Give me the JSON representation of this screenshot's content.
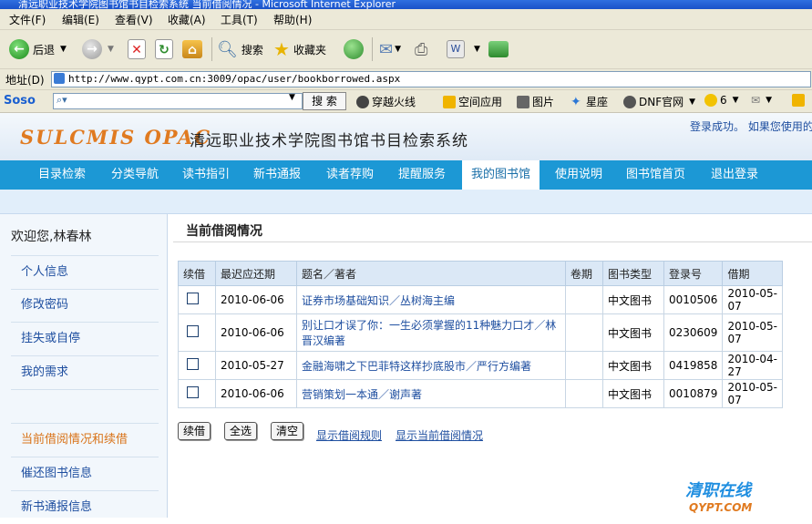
{
  "window": {
    "title": "清远职业技术学院图书馆书目检索系统 当前借阅情况 - Microsoft Internet Explorer"
  },
  "menu": [
    "文件(F)",
    "编辑(E)",
    "查看(V)",
    "收藏(A)",
    "工具(T)",
    "帮助(H)"
  ],
  "toolbar": {
    "back": "后退",
    "search": "搜索",
    "favorites": "收藏夹"
  },
  "address": {
    "label": "地址(D)",
    "url": "http://www.qypt.com.cn:3009/opac/user/bookborrowed.aspx"
  },
  "soso": {
    "brand": "Soso",
    "search_btn": "搜 索",
    "items": [
      "穿越火线",
      "空间应用",
      "图片",
      "星座",
      "DNF官网",
      "6"
    ]
  },
  "site": {
    "logo_en": "SULCMIS OPAC",
    "logo_cn": "清远职业技术学院图书馆书目检索系统",
    "login_msg": "登录成功。 如果您使用的"
  },
  "nav": [
    "目录检索",
    "分类导航",
    "读书指引",
    "新书通报",
    "读者荐购",
    "提醒服务",
    "我的图书馆",
    "使用说明",
    "图书馆首页",
    "退出登录"
  ],
  "sidebar": {
    "welcome": "欢迎您,林春林",
    "items": [
      "个人信息",
      "修改密码",
      "挂失或自停",
      "我的需求",
      "",
      "当前借阅情况和续借",
      "催还图书信息",
      "新书通报信息"
    ]
  },
  "main": {
    "title": "当前借阅情况",
    "headers": [
      "续借",
      "最迟应还期",
      "题名／著者",
      "卷期",
      "图书类型",
      "登录号",
      "借期"
    ],
    "rows": [
      {
        "due": "2010-06-06",
        "title": "证券市场基础知识／丛树海主编",
        "vol": "",
        "type": "中文图书",
        "reg": "0010506",
        "borrow": "2010-05-07"
      },
      {
        "due": "2010-06-06",
        "title": "别让口才误了你：一生必须掌握的11种魅力口才／林晋汉编著",
        "vol": "",
        "type": "中文图书",
        "reg": "0230609",
        "borrow": "2010-05-07"
      },
      {
        "due": "2010-05-27",
        "title": "金融海啸之下巴菲特这样抄底股市／严行方编著",
        "vol": "",
        "type": "中文图书",
        "reg": "0419858",
        "borrow": "2010-04-27"
      },
      {
        "due": "2010-06-06",
        "title": "营销策划一本通／谢声著",
        "vol": "",
        "type": "中文图书",
        "reg": "0010879",
        "borrow": "2010-05-07"
      }
    ],
    "buttons": {
      "renew": "续借",
      "select_all": "全选",
      "clear": "清空"
    },
    "links": {
      "rules": "显示借阅规则",
      "current": "显示当前借阅情况"
    }
  },
  "watermark": {
    "cn": "清职在线",
    "en": "QYPT.COM"
  }
}
